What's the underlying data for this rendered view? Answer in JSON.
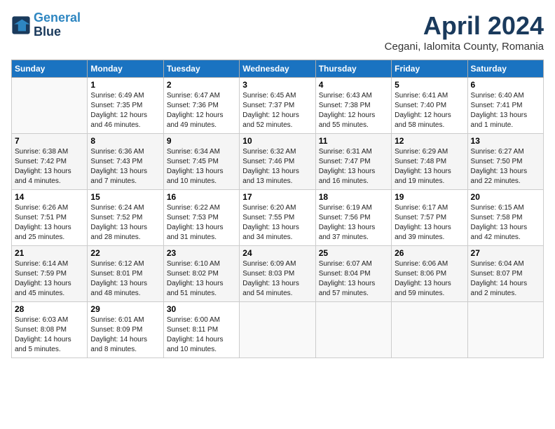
{
  "app": {
    "logo_line1": "General",
    "logo_line2": "Blue"
  },
  "header": {
    "month": "April 2024",
    "location": "Cegani, Ialomita County, Romania"
  },
  "weekdays": [
    "Sunday",
    "Monday",
    "Tuesday",
    "Wednesday",
    "Thursday",
    "Friday",
    "Saturday"
  ],
  "weeks": [
    [
      {
        "day": "",
        "sunrise": "",
        "sunset": "",
        "daylight": ""
      },
      {
        "day": "1",
        "sunrise": "Sunrise: 6:49 AM",
        "sunset": "Sunset: 7:35 PM",
        "daylight": "Daylight: 12 hours and 46 minutes."
      },
      {
        "day": "2",
        "sunrise": "Sunrise: 6:47 AM",
        "sunset": "Sunset: 7:36 PM",
        "daylight": "Daylight: 12 hours and 49 minutes."
      },
      {
        "day": "3",
        "sunrise": "Sunrise: 6:45 AM",
        "sunset": "Sunset: 7:37 PM",
        "daylight": "Daylight: 12 hours and 52 minutes."
      },
      {
        "day": "4",
        "sunrise": "Sunrise: 6:43 AM",
        "sunset": "Sunset: 7:38 PM",
        "daylight": "Daylight: 12 hours and 55 minutes."
      },
      {
        "day": "5",
        "sunrise": "Sunrise: 6:41 AM",
        "sunset": "Sunset: 7:40 PM",
        "daylight": "Daylight: 12 hours and 58 minutes."
      },
      {
        "day": "6",
        "sunrise": "Sunrise: 6:40 AM",
        "sunset": "Sunset: 7:41 PM",
        "daylight": "Daylight: 13 hours and 1 minute."
      }
    ],
    [
      {
        "day": "7",
        "sunrise": "Sunrise: 6:38 AM",
        "sunset": "Sunset: 7:42 PM",
        "daylight": "Daylight: 13 hours and 4 minutes."
      },
      {
        "day": "8",
        "sunrise": "Sunrise: 6:36 AM",
        "sunset": "Sunset: 7:43 PM",
        "daylight": "Daylight: 13 hours and 7 minutes."
      },
      {
        "day": "9",
        "sunrise": "Sunrise: 6:34 AM",
        "sunset": "Sunset: 7:45 PM",
        "daylight": "Daylight: 13 hours and 10 minutes."
      },
      {
        "day": "10",
        "sunrise": "Sunrise: 6:32 AM",
        "sunset": "Sunset: 7:46 PM",
        "daylight": "Daylight: 13 hours and 13 minutes."
      },
      {
        "day": "11",
        "sunrise": "Sunrise: 6:31 AM",
        "sunset": "Sunset: 7:47 PM",
        "daylight": "Daylight: 13 hours and 16 minutes."
      },
      {
        "day": "12",
        "sunrise": "Sunrise: 6:29 AM",
        "sunset": "Sunset: 7:48 PM",
        "daylight": "Daylight: 13 hours and 19 minutes."
      },
      {
        "day": "13",
        "sunrise": "Sunrise: 6:27 AM",
        "sunset": "Sunset: 7:50 PM",
        "daylight": "Daylight: 13 hours and 22 minutes."
      }
    ],
    [
      {
        "day": "14",
        "sunrise": "Sunrise: 6:26 AM",
        "sunset": "Sunset: 7:51 PM",
        "daylight": "Daylight: 13 hours and 25 minutes."
      },
      {
        "day": "15",
        "sunrise": "Sunrise: 6:24 AM",
        "sunset": "Sunset: 7:52 PM",
        "daylight": "Daylight: 13 hours and 28 minutes."
      },
      {
        "day": "16",
        "sunrise": "Sunrise: 6:22 AM",
        "sunset": "Sunset: 7:53 PM",
        "daylight": "Daylight: 13 hours and 31 minutes."
      },
      {
        "day": "17",
        "sunrise": "Sunrise: 6:20 AM",
        "sunset": "Sunset: 7:55 PM",
        "daylight": "Daylight: 13 hours and 34 minutes."
      },
      {
        "day": "18",
        "sunrise": "Sunrise: 6:19 AM",
        "sunset": "Sunset: 7:56 PM",
        "daylight": "Daylight: 13 hours and 37 minutes."
      },
      {
        "day": "19",
        "sunrise": "Sunrise: 6:17 AM",
        "sunset": "Sunset: 7:57 PM",
        "daylight": "Daylight: 13 hours and 39 minutes."
      },
      {
        "day": "20",
        "sunrise": "Sunrise: 6:15 AM",
        "sunset": "Sunset: 7:58 PM",
        "daylight": "Daylight: 13 hours and 42 minutes."
      }
    ],
    [
      {
        "day": "21",
        "sunrise": "Sunrise: 6:14 AM",
        "sunset": "Sunset: 7:59 PM",
        "daylight": "Daylight: 13 hours and 45 minutes."
      },
      {
        "day": "22",
        "sunrise": "Sunrise: 6:12 AM",
        "sunset": "Sunset: 8:01 PM",
        "daylight": "Daylight: 13 hours and 48 minutes."
      },
      {
        "day": "23",
        "sunrise": "Sunrise: 6:10 AM",
        "sunset": "Sunset: 8:02 PM",
        "daylight": "Daylight: 13 hours and 51 minutes."
      },
      {
        "day": "24",
        "sunrise": "Sunrise: 6:09 AM",
        "sunset": "Sunset: 8:03 PM",
        "daylight": "Daylight: 13 hours and 54 minutes."
      },
      {
        "day": "25",
        "sunrise": "Sunrise: 6:07 AM",
        "sunset": "Sunset: 8:04 PM",
        "daylight": "Daylight: 13 hours and 57 minutes."
      },
      {
        "day": "26",
        "sunrise": "Sunrise: 6:06 AM",
        "sunset": "Sunset: 8:06 PM",
        "daylight": "Daylight: 13 hours and 59 minutes."
      },
      {
        "day": "27",
        "sunrise": "Sunrise: 6:04 AM",
        "sunset": "Sunset: 8:07 PM",
        "daylight": "Daylight: 14 hours and 2 minutes."
      }
    ],
    [
      {
        "day": "28",
        "sunrise": "Sunrise: 6:03 AM",
        "sunset": "Sunset: 8:08 PM",
        "daylight": "Daylight: 14 hours and 5 minutes."
      },
      {
        "day": "29",
        "sunrise": "Sunrise: 6:01 AM",
        "sunset": "Sunset: 8:09 PM",
        "daylight": "Daylight: 14 hours and 8 minutes."
      },
      {
        "day": "30",
        "sunrise": "Sunrise: 6:00 AM",
        "sunset": "Sunset: 8:11 PM",
        "daylight": "Daylight: 14 hours and 10 minutes."
      },
      {
        "day": "",
        "sunrise": "",
        "sunset": "",
        "daylight": ""
      },
      {
        "day": "",
        "sunrise": "",
        "sunset": "",
        "daylight": ""
      },
      {
        "day": "",
        "sunrise": "",
        "sunset": "",
        "daylight": ""
      },
      {
        "day": "",
        "sunrise": "",
        "sunset": "",
        "daylight": ""
      }
    ]
  ]
}
